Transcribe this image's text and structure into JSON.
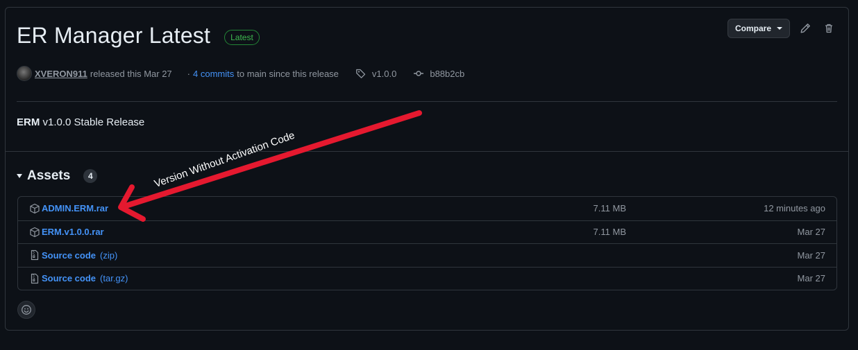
{
  "release": {
    "title": "ER Manager Latest",
    "badge": "Latest",
    "author": "XVERON911",
    "released_text": "released this Mar 27",
    "commits_prefix": "·",
    "commits_link": "4 commits",
    "commits_suffix": "to main since this release",
    "tag": "v1.0.0",
    "commit_hash": "b88b2cb",
    "body_bold": "ERM",
    "body_rest": "v1.0.0 Stable Release"
  },
  "actions": {
    "compare_label": "Compare",
    "edit_icon": "pencil-icon",
    "delete_icon": "trash-icon"
  },
  "assets": {
    "title": "Assets",
    "count": "4",
    "items": [
      {
        "name": "ADMIN.ERM.rar",
        "ext": "",
        "size": "7.11 MB",
        "date": "12 minutes ago",
        "icon": "package-icon"
      },
      {
        "name": "ERM.v1.0.0.rar",
        "ext": "",
        "size": "7.11 MB",
        "date": "Mar 27",
        "icon": "package-icon"
      },
      {
        "name": "Source code",
        "ext": "(zip)",
        "size": "",
        "date": "Mar 27",
        "icon": "file-zip-icon"
      },
      {
        "name": "Source code",
        "ext": "(tar.gz)",
        "size": "",
        "date": "Mar 27",
        "icon": "file-zip-icon"
      }
    ]
  },
  "annotation": {
    "text": "Version Without Activation Code",
    "color": "#e5192f"
  },
  "colors": {
    "background": "#0d1117",
    "link": "#4493f8",
    "latest_green": "#3fb950",
    "border": "#30363d"
  }
}
